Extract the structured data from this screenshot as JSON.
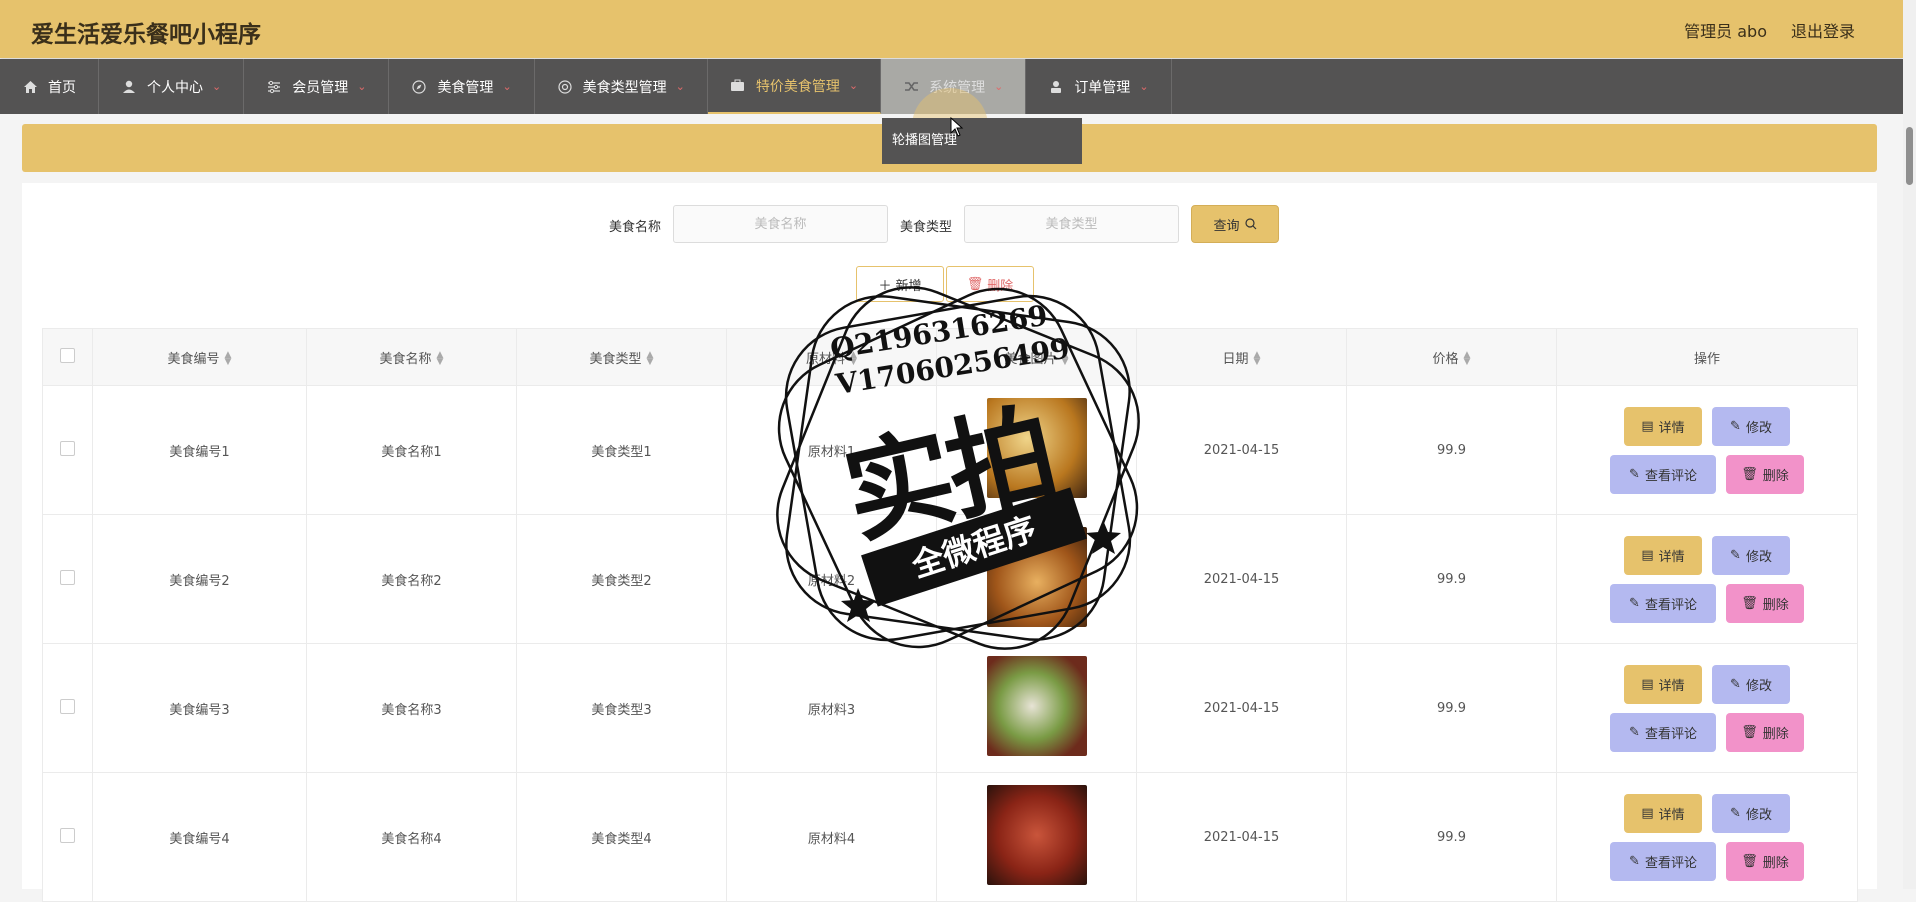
{
  "header": {
    "title": "爱生活爱乐餐吧小程序",
    "admin": "管理员 abo",
    "logout": "退出登录"
  },
  "nav": [
    {
      "label": "首页",
      "icon": "home-icon",
      "has_menu": false
    },
    {
      "label": "个人中心",
      "icon": "user-icon",
      "has_menu": true
    },
    {
      "label": "会员管理",
      "icon": "sliders-icon",
      "has_menu": true
    },
    {
      "label": "美食管理",
      "icon": "compass-icon",
      "has_menu": true
    },
    {
      "label": "美食类型管理",
      "icon": "disc-icon",
      "has_menu": true
    },
    {
      "label": "特价美食管理",
      "icon": "briefcase-icon",
      "has_menu": true
    },
    {
      "label": "系统管理",
      "icon": "shuffle-icon",
      "has_menu": true
    },
    {
      "label": "订单管理",
      "icon": "user-card-icon",
      "has_menu": true
    }
  ],
  "dropdown": {
    "item": "轮播图管理"
  },
  "search": {
    "name_label": "美食名称",
    "name_placeholder": "美食名称",
    "type_label": "美食类型",
    "type_placeholder": "美食类型",
    "query_label": "查询"
  },
  "actions": {
    "add": "新增",
    "delete": "删除"
  },
  "table": {
    "headers": [
      "美食编号",
      "美食名称",
      "美食类型",
      "原材料",
      "美食图片",
      "日期",
      "价格",
      "操作"
    ],
    "rows": [
      {
        "code": "美食编号1",
        "name": "美食名称1",
        "type": "美食类型1",
        "material": "原材料1",
        "date": "2021-04-15",
        "price": "99.9"
      },
      {
        "code": "美食编号2",
        "name": "美食名称2",
        "type": "美食类型2",
        "material": "原材料2",
        "date": "2021-04-15",
        "price": "99.9"
      },
      {
        "code": "美食编号3",
        "name": "美食名称3",
        "type": "美食类型3",
        "material": "原材料3",
        "date": "2021-04-15",
        "price": "99.9"
      },
      {
        "code": "美食编号4",
        "name": "美食名称4",
        "type": "美食类型4",
        "material": "原材料4",
        "date": "2021-04-15",
        "price": "99.9"
      }
    ],
    "op_labels": {
      "detail": "详情",
      "edit": "修改",
      "review": "查看评论",
      "delete": "删除"
    }
  },
  "watermark": {
    "line1": "Q2196316269",
    "line2": "V17060256499",
    "big": "实拍",
    "ribbon": "全微程序"
  },
  "colors": {
    "primary": "#e6c26c",
    "nav_bg": "#545353",
    "edit": "#b4b9f0",
    "delete": "#f292c9"
  }
}
